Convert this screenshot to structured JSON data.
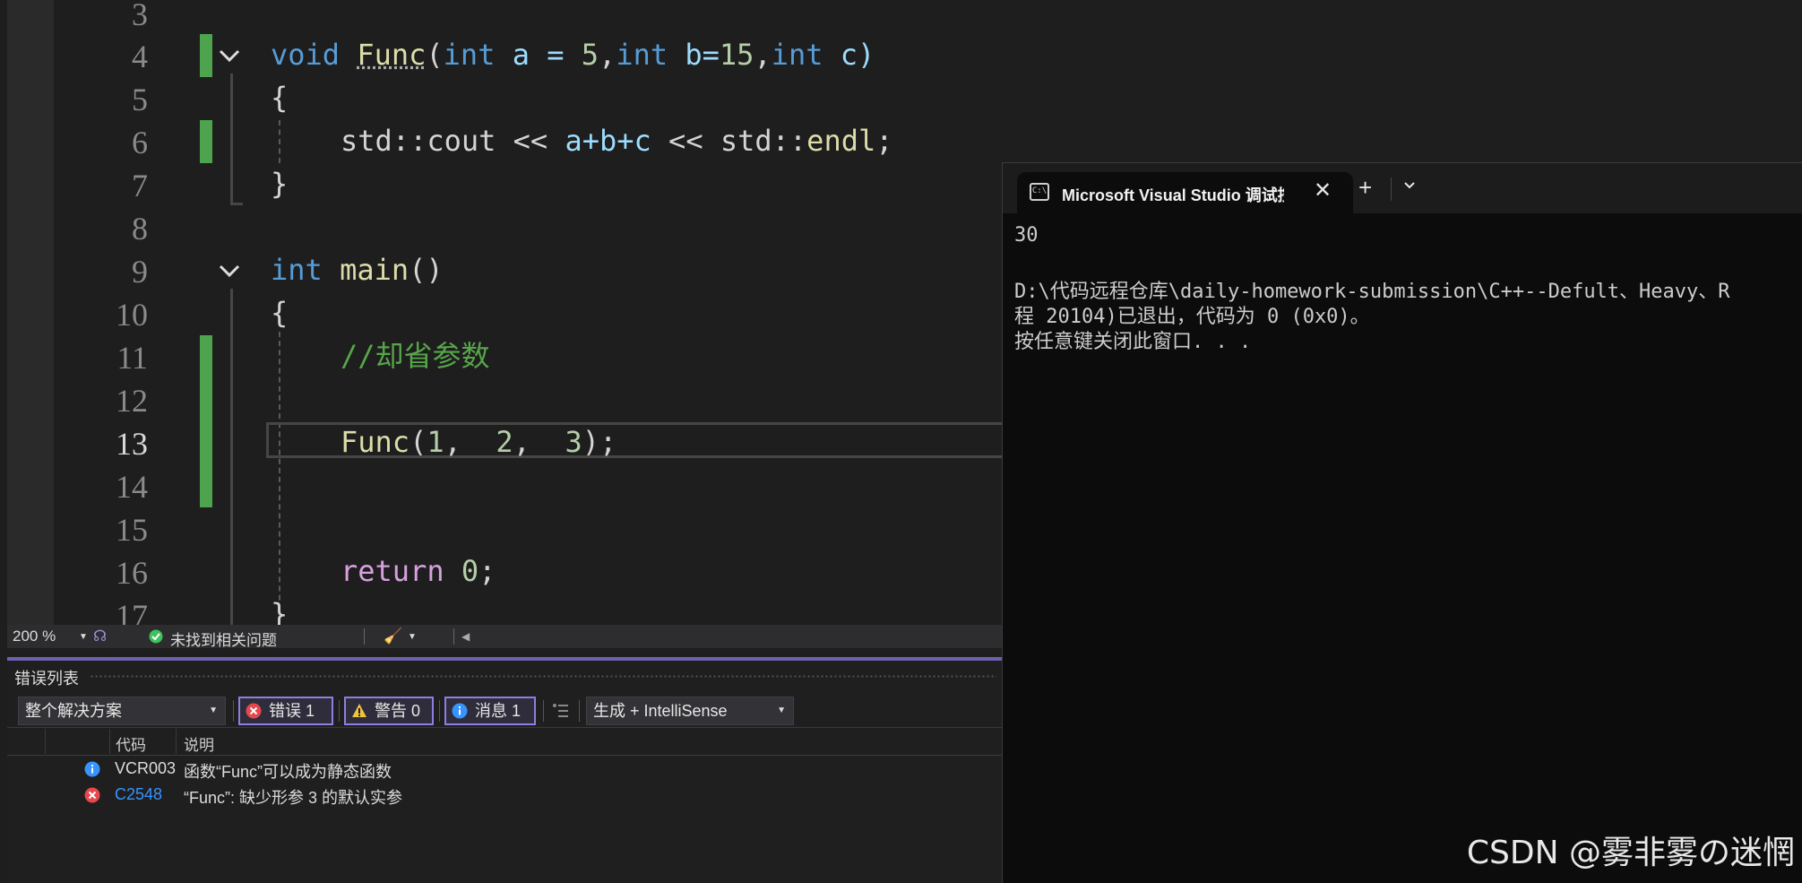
{
  "editor": {
    "line_numbers": [
      "3",
      "4",
      "5",
      "6",
      "7",
      "8",
      "9",
      "10",
      "11",
      "12",
      "13",
      "14",
      "15",
      "16",
      "17"
    ],
    "active_line": "13",
    "code": {
      "l4": {
        "t1": "void",
        "t2": "Func",
        "t3": "(",
        "t4": "int",
        "t5": " a = ",
        "t6": "5",
        "t7": ",",
        "t8": "int",
        "t9": " b=",
        "t10": "15",
        "t11": ",",
        "t12": "int",
        "t13": " c)"
      },
      "l5": "{",
      "l6": {
        "t1": "std::",
        "t2": "cout",
        "t3": " << ",
        "t4": "a+b+c",
        "t5": " << ",
        "t6": "std::",
        "t7": "endl",
        "t8": ";"
      },
      "l7": "}",
      "l9": {
        "t1": "int",
        "t2": " ",
        "t3": "main",
        "t4": "()"
      },
      "l10": "{",
      "l11": "//却省参数",
      "l13": {
        "t1": "Func",
        "t2": "(",
        "t3": "1",
        "t4": ",  ",
        "t5": "2",
        "t6": ",  ",
        "t7": "3",
        "t8": ");"
      },
      "l16": {
        "t1": "return",
        "t2": " ",
        "t3": "0",
        "t4": ";"
      },
      "l17": "}"
    },
    "status": {
      "zoom": "200 %",
      "issues": "未找到相关问题"
    }
  },
  "error_list": {
    "title": "错误列表",
    "scope": "整个解决方案",
    "errors_btn": "错误 1",
    "warnings_btn": "警告 0",
    "messages_btn": "消息 1",
    "source": "生成 + IntelliSense",
    "columns": {
      "code": "代码",
      "desc": "说明"
    },
    "rows": [
      {
        "type": "info",
        "code": "VCR003",
        "desc": "函数“Func”可以成为静态函数"
      },
      {
        "type": "error",
        "code": "C2548",
        "desc": "“Func”: 缺少形参 3 的默认实参"
      }
    ]
  },
  "terminal": {
    "tab_title": "Microsoft Visual Studio 调试控制台",
    "lines": [
      "30",
      "",
      "D:\\代码远程仓库\\daily-homework-submission\\C++--Defult、Heavy、R",
      "程 20104)已退出，代码为 0 (0x0)。",
      "按任意键关闭此窗口. . ."
    ]
  },
  "watermark": "CSDN @雾非雾の迷惘",
  "colors": {
    "keyword": "#569cd6",
    "function": "#dcdcaa",
    "number": "#b5cea8",
    "comment": "#57a64a",
    "control": "#d8a0df",
    "change_bar": "#4ea34e",
    "accent": "#8d7fe0"
  }
}
